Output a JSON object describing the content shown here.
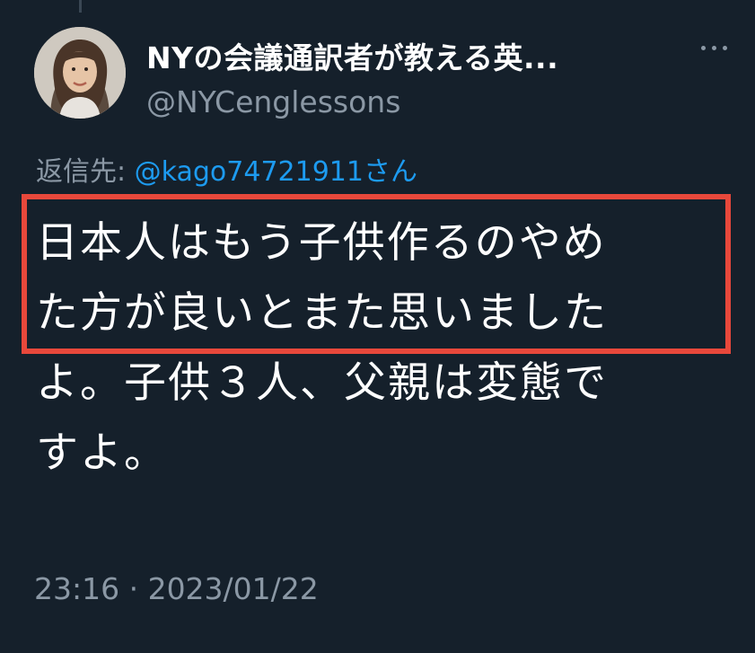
{
  "tweet": {
    "display_name": "NYの会議通訳者が教える英...",
    "handle": "@NYCenglessons",
    "reply_to_label": "返信先: ",
    "reply_to_user": "@kago74721911",
    "reply_to_suffix": "さん",
    "body_lines": [
      "日本人はもう子供作るのやめ",
      "た方が良いとまた思いました",
      "よ。子供３人、父親は変態で",
      "すよ。"
    ],
    "timestamp": "23:16 · 2023/01/22"
  },
  "icons": {
    "more": "more-options-icon",
    "avatar": "profile-avatar"
  },
  "colors": {
    "background": "#15202b",
    "secondary_text": "#8b98a5",
    "link": "#1d9bf0",
    "highlight": "#e8483b"
  }
}
